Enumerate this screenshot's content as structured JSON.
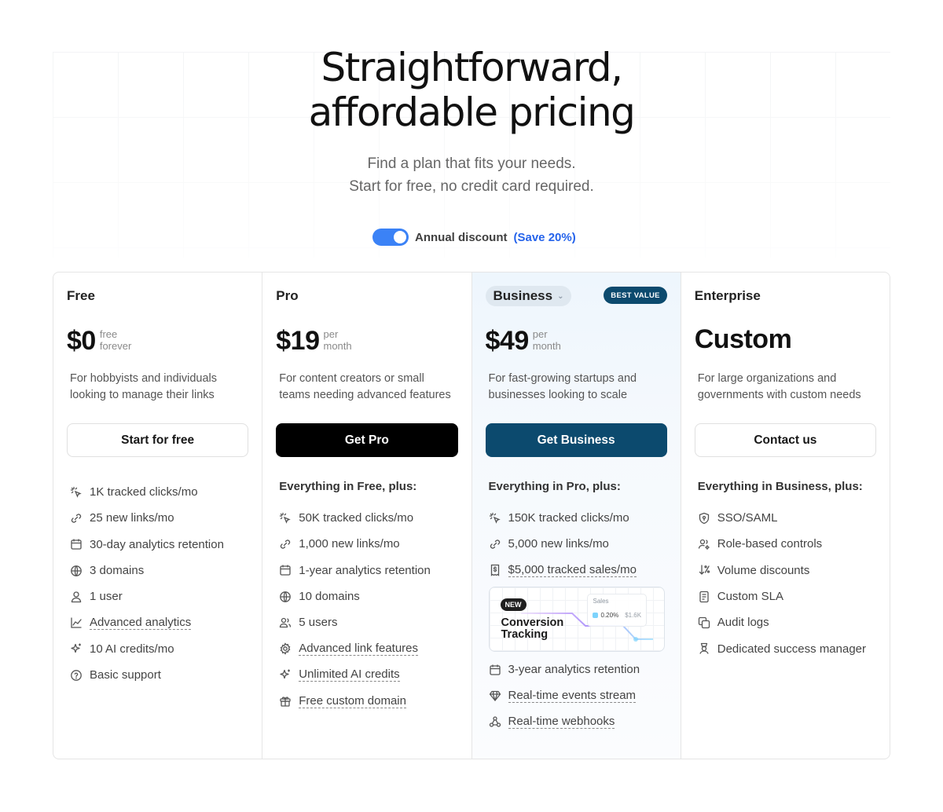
{
  "hero": {
    "title_line1": "Straightforward,",
    "title_line2": "affordable pricing",
    "subtitle_line1": "Find a plan that fits your needs.",
    "subtitle_line2": "Start for free, no credit card required.",
    "toggle_label": "Annual discount",
    "toggle_save": "(Save 20%)",
    "toggle_on": true
  },
  "colors": {
    "accent_blue": "#3b82f6",
    "navy": "#0c4a6e",
    "black": "#000000"
  },
  "plans": {
    "free": {
      "name": "Free",
      "price": "$0",
      "unit_line1": "free",
      "unit_line2": "forever",
      "description": "For hobbyists and individuals looking to manage their links",
      "cta": "Start for free",
      "features": [
        {
          "icon": "cursor-rays-icon",
          "text": "1K tracked clicks/mo"
        },
        {
          "icon": "link-icon",
          "text": "25 new links/mo"
        },
        {
          "icon": "calendar-icon",
          "text": "30-day analytics retention"
        },
        {
          "icon": "globe-icon",
          "text": "3 domains"
        },
        {
          "icon": "user-icon",
          "text": "1 user"
        },
        {
          "icon": "chart-line-icon",
          "text": "Advanced analytics"
        },
        {
          "icon": "sparkles-icon",
          "text": "10 AI credits/mo"
        },
        {
          "icon": "help-circle-icon",
          "text": "Basic support"
        }
      ]
    },
    "pro": {
      "name": "Pro",
      "price": "$19",
      "unit_line1": "per",
      "unit_line2": "month",
      "description": "For content creators or small teams needing advanced features",
      "cta": "Get Pro",
      "features_heading": "Everything in Free, plus:",
      "features": [
        {
          "icon": "cursor-rays-icon",
          "text": "50K tracked clicks/mo"
        },
        {
          "icon": "link-icon",
          "text": "1,000 new links/mo"
        },
        {
          "icon": "calendar-icon",
          "text": "1-year analytics retention"
        },
        {
          "icon": "globe-icon",
          "text": "10 domains"
        },
        {
          "icon": "users-icon",
          "text": "5 users"
        },
        {
          "icon": "gear-icon",
          "text": "Advanced link features"
        },
        {
          "icon": "sparkles-icon",
          "text": "Unlimited AI credits"
        },
        {
          "icon": "gift-icon",
          "text": "Free custom domain"
        }
      ]
    },
    "business": {
      "name": "Business",
      "badge": "BEST VALUE",
      "price": "$49",
      "unit_line1": "per",
      "unit_line2": "month",
      "description": "For fast-growing startups and businesses looking to scale",
      "cta": "Get Business",
      "features_heading": "Everything in Pro, plus:",
      "features": [
        {
          "icon": "cursor-rays-icon",
          "text": "150K tracked clicks/mo"
        },
        {
          "icon": "link-icon",
          "text": "5,000 new links/mo"
        },
        {
          "icon": "invoice-dollar-icon",
          "text": "$5,000 tracked sales/mo"
        }
      ],
      "conversion_card": {
        "badge": "NEW",
        "title_line1": "Conversion",
        "title_line2": "Tracking",
        "sales_label": "Sales",
        "sales_rate": "0.20%",
        "sales_amount": "$1.6K"
      },
      "features_after": [
        {
          "icon": "calendar-icon",
          "text": "3-year analytics retention"
        },
        {
          "icon": "diamond-icon",
          "text": "Real-time events stream"
        },
        {
          "icon": "webhook-icon",
          "text": "Real-time webhooks"
        }
      ]
    },
    "enterprise": {
      "name": "Enterprise",
      "price": "Custom",
      "description": "For large organizations and governments with custom needs",
      "cta": "Contact us",
      "features_heading": "Everything in Business, plus:",
      "features": [
        {
          "icon": "shield-key-icon",
          "text": "SSO/SAML"
        },
        {
          "icon": "users-settings-icon",
          "text": "Role-based controls"
        },
        {
          "icon": "arrow-down-percent-icon",
          "text": "Volume discounts"
        },
        {
          "icon": "document-icon",
          "text": "Custom SLA"
        },
        {
          "icon": "copy-icon",
          "text": "Audit logs"
        },
        {
          "icon": "headset-icon",
          "text": "Dedicated success manager"
        }
      ]
    }
  }
}
